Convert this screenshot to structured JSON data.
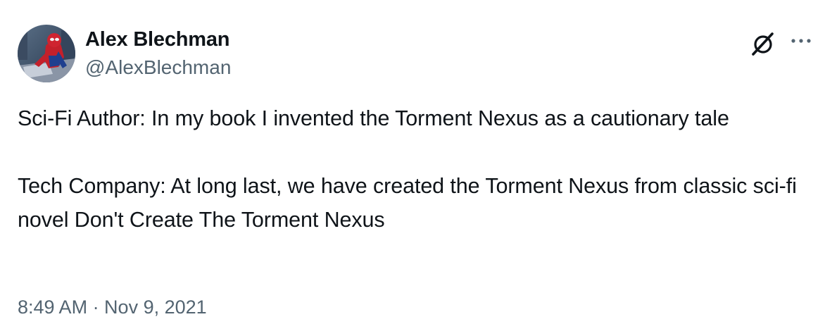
{
  "author": {
    "display_name": "Alex Blechman",
    "handle": "@AlexBlechman"
  },
  "icons": {
    "avatar": "spiderman-avatar",
    "grok": "grok-icon",
    "more": "more-options-icon"
  },
  "tweet": {
    "paragraph_1": "Sci-Fi Author: In my book I invented the Torment Nexus as a cautionary tale",
    "paragraph_2": "Tech Company: At long last, we have created the Torment Nexus from classic sci-fi novel Don't Create The Torment Nexus",
    "timestamp": "8:49 AM · Nov 9, 2021"
  },
  "colors": {
    "text": "#0f1419",
    "secondary": "#536471",
    "background": "#ffffff"
  }
}
